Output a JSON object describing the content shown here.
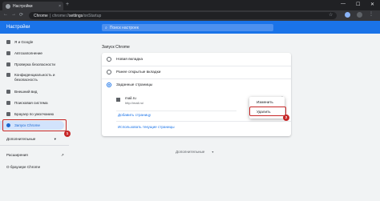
{
  "tab": {
    "title": "Настройки",
    "close": "×",
    "new_tab": "+"
  },
  "window_controls": {
    "minimize": "—",
    "maximize": "☐",
    "close": "✕"
  },
  "nav": {
    "back": "←",
    "forward": "→",
    "reload": "⟳"
  },
  "omnibox": {
    "site_chip": "Chrome",
    "separator": "|",
    "url_prefix": "chrome://",
    "url_host": "settings",
    "url_path": "/onStartup"
  },
  "header": {
    "title": "Настройки",
    "search_placeholder": "Поиск настроек",
    "search_icon": "⌕"
  },
  "sidebar": {
    "items": [
      {
        "label": "Я и Google",
        "icon": "person-icon"
      },
      {
        "label": "Автозаполнение",
        "icon": "clipboard-icon"
      },
      {
        "label": "Проверка безопасности",
        "icon": "shield-check-icon"
      },
      {
        "label": "Конфиденциальность и безопасность",
        "icon": "shield-icon"
      },
      {
        "label": "Внешний вид",
        "icon": "palette-icon"
      },
      {
        "label": "Поисковая система",
        "icon": "search-icon"
      },
      {
        "label": "Браузер по умолчанию",
        "icon": "browser-icon"
      },
      {
        "label": "Запуск Chrome",
        "icon": "power-icon"
      }
    ],
    "advanced": "Дополнительные",
    "advanced_chevron": "▾",
    "extensions": "Расширения",
    "extensions_icon": "↗",
    "about": "О браузере Chrome"
  },
  "main": {
    "section_title": "Запуск Chrome",
    "options": [
      {
        "label": "Новая вкладка",
        "selected": false
      },
      {
        "label": "Ранее открытые вкладки",
        "selected": false
      },
      {
        "label": "Заданные страницы",
        "selected": true
      }
    ],
    "page": {
      "name": "mail.ru",
      "url": "http://mail.ru/"
    },
    "add_page": "Добавить страницу",
    "use_current": "Использовать текущие страницы",
    "advanced": "Дополнительные",
    "advanced_chevron": "▾"
  },
  "context_menu": {
    "items": [
      "Изменить",
      "Удалить"
    ]
  },
  "annotations": {
    "badge_1": "1",
    "badge_2": "2",
    "highlight_color": "#c62828"
  },
  "colors": {
    "accent": "#1a73e8",
    "header_bg": "#1a73e8",
    "dark_bg": "#202124"
  }
}
